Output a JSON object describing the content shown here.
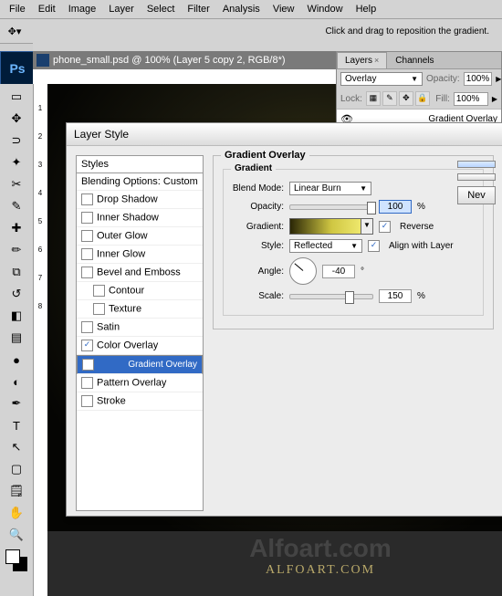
{
  "menu": {
    "file": "File",
    "edit": "Edit",
    "image": "Image",
    "layer": "Layer",
    "select": "Select",
    "filter": "Filter",
    "analysis": "Analysis",
    "view": "View",
    "window": "Window",
    "help": "Help"
  },
  "hint": "Click and drag to reposition the gradient.",
  "doc_title": "phone_small.psd @ 100% (Layer 5 copy 2, RGB/8*)",
  "ps_label": "Ps",
  "winbtns": {
    "min": "—",
    "max": "▭",
    "close": "✕"
  },
  "ruler_v": [
    "1",
    "2",
    "3",
    "4",
    "5",
    "6",
    "7",
    "8"
  ],
  "layers_panel": {
    "tab1": "Layers",
    "tab2": "Channels",
    "blend": "Overlay",
    "opacity_label": "Opacity:",
    "opacity": "100%",
    "lock_label": "Lock:",
    "fill_label": "Fill:",
    "fill": "100%",
    "effect": "Gradient Overlay"
  },
  "dialog": {
    "title": "Layer Style",
    "styles_hdr": "Styles",
    "blend_opts": "Blending Options: Custom",
    "effects": [
      "Drop Shadow",
      "Inner Shadow",
      "Outer Glow",
      "Inner Glow",
      "Bevel and Emboss",
      "Contour",
      "Texture",
      "Satin",
      "Color Overlay",
      "Gradient Overlay",
      "Pattern Overlay",
      "Stroke"
    ],
    "group_title": "Gradient Overlay",
    "sub_title": "Gradient",
    "blendmode_label": "Blend Mode:",
    "blendmode": "Linear Burn",
    "opacity_label": "Opacity:",
    "opacity": "100",
    "pct": "%",
    "gradient_label": "Gradient:",
    "reverse": "Reverse",
    "style_label": "Style:",
    "style": "Reflected",
    "align": "Align with Layer",
    "angle_label": "Angle:",
    "angle": "-40",
    "deg": "°",
    "scale_label": "Scale:",
    "scale": "150",
    "new_btn": "Nev"
  },
  "watermark": {
    "w1": "Alfoart.com",
    "w2": "ALFOART.COM"
  }
}
